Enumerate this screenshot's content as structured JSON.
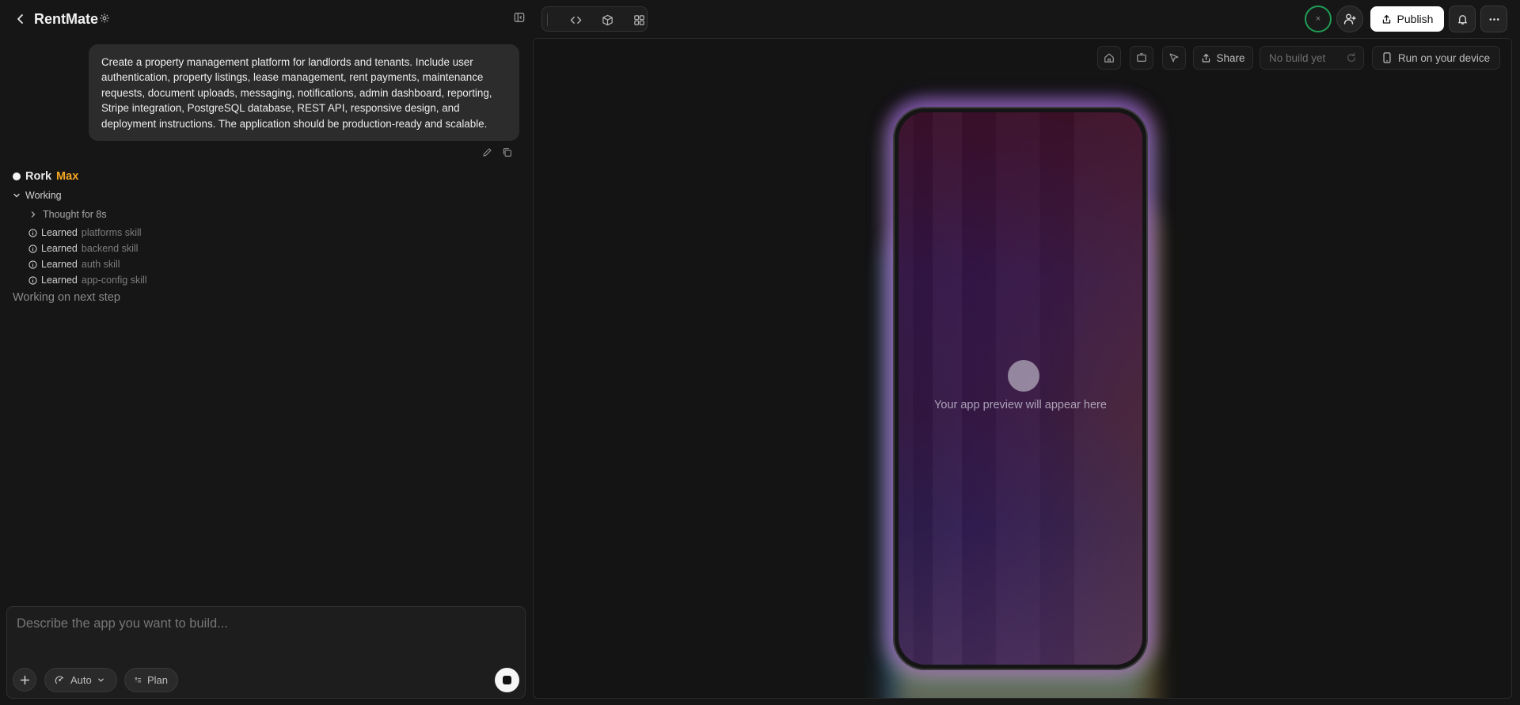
{
  "header": {
    "app_title": "RentMate"
  },
  "chat": {
    "user_message": "Create a property management platform for landlords and tenants. Include user authentication, property listings, lease management, rent payments, maintenance requests, document uploads, messaging, notifications, admin dashboard, reporting, Stripe integration, PostgreSQL database, REST API, responsive design, and deployment instructions. The application should be production-ready and scalable.",
    "agent_name_primary": "Rork",
    "agent_name_secondary": "Max",
    "working_label": "Working",
    "thought_label": "Thought for 8s",
    "learned_prefix": "Learned",
    "skills": [
      "platforms skill",
      "backend skill",
      "auth skill",
      "app-config skill"
    ],
    "status_text": "Working on next step"
  },
  "composer": {
    "placeholder": "Describe the app you want to build...",
    "mode_label": "Auto",
    "plan_label": "Plan"
  },
  "toolbar": {
    "publish_label": "Publish",
    "status_ring_glyph": "×"
  },
  "preview": {
    "share_label": "Share",
    "build_status": "No build yet",
    "run_device_label": "Run on your device",
    "placeholder_text": "Your app preview will appear here"
  },
  "colors": {
    "accent_max": "#f5a623",
    "status_ring": "#1f9d55",
    "background": "#161616"
  }
}
